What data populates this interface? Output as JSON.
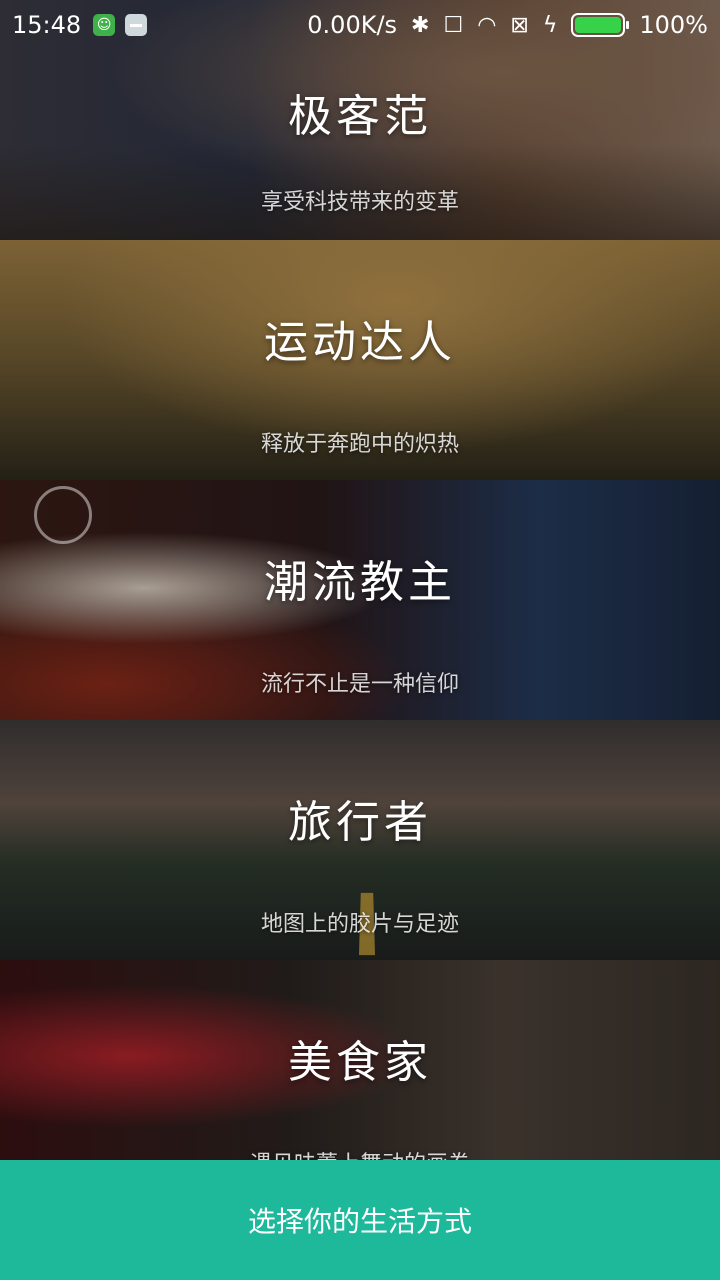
{
  "status_bar": {
    "time": "15:48",
    "network_speed": "0.00K/s",
    "battery_percent": "100%",
    "battery_level": 1.0,
    "icons": [
      "app-green-icon",
      "app-gray-icon",
      "bluetooth-icon",
      "vibrate-off-icon",
      "wifi-icon",
      "no-sim-icon",
      "charging-icon",
      "battery-icon"
    ]
  },
  "categories": [
    {
      "title": "极客范",
      "subtitle": "享受科技带来的变革"
    },
    {
      "title": "运动达人",
      "subtitle": "释放于奔跑中的炽热"
    },
    {
      "title": "潮流教主",
      "subtitle": "流行不止是一种信仰"
    },
    {
      "title": "旅行者",
      "subtitle": "地图上的胶片与足迹"
    },
    {
      "title": "美食家",
      "subtitle": "遇见味蕾上舞动的画卷"
    }
  ],
  "bottom_button": {
    "label": "选择你的生活方式"
  },
  "colors": {
    "accent": "#1eb89b",
    "battery_fill": "#35d24a"
  }
}
